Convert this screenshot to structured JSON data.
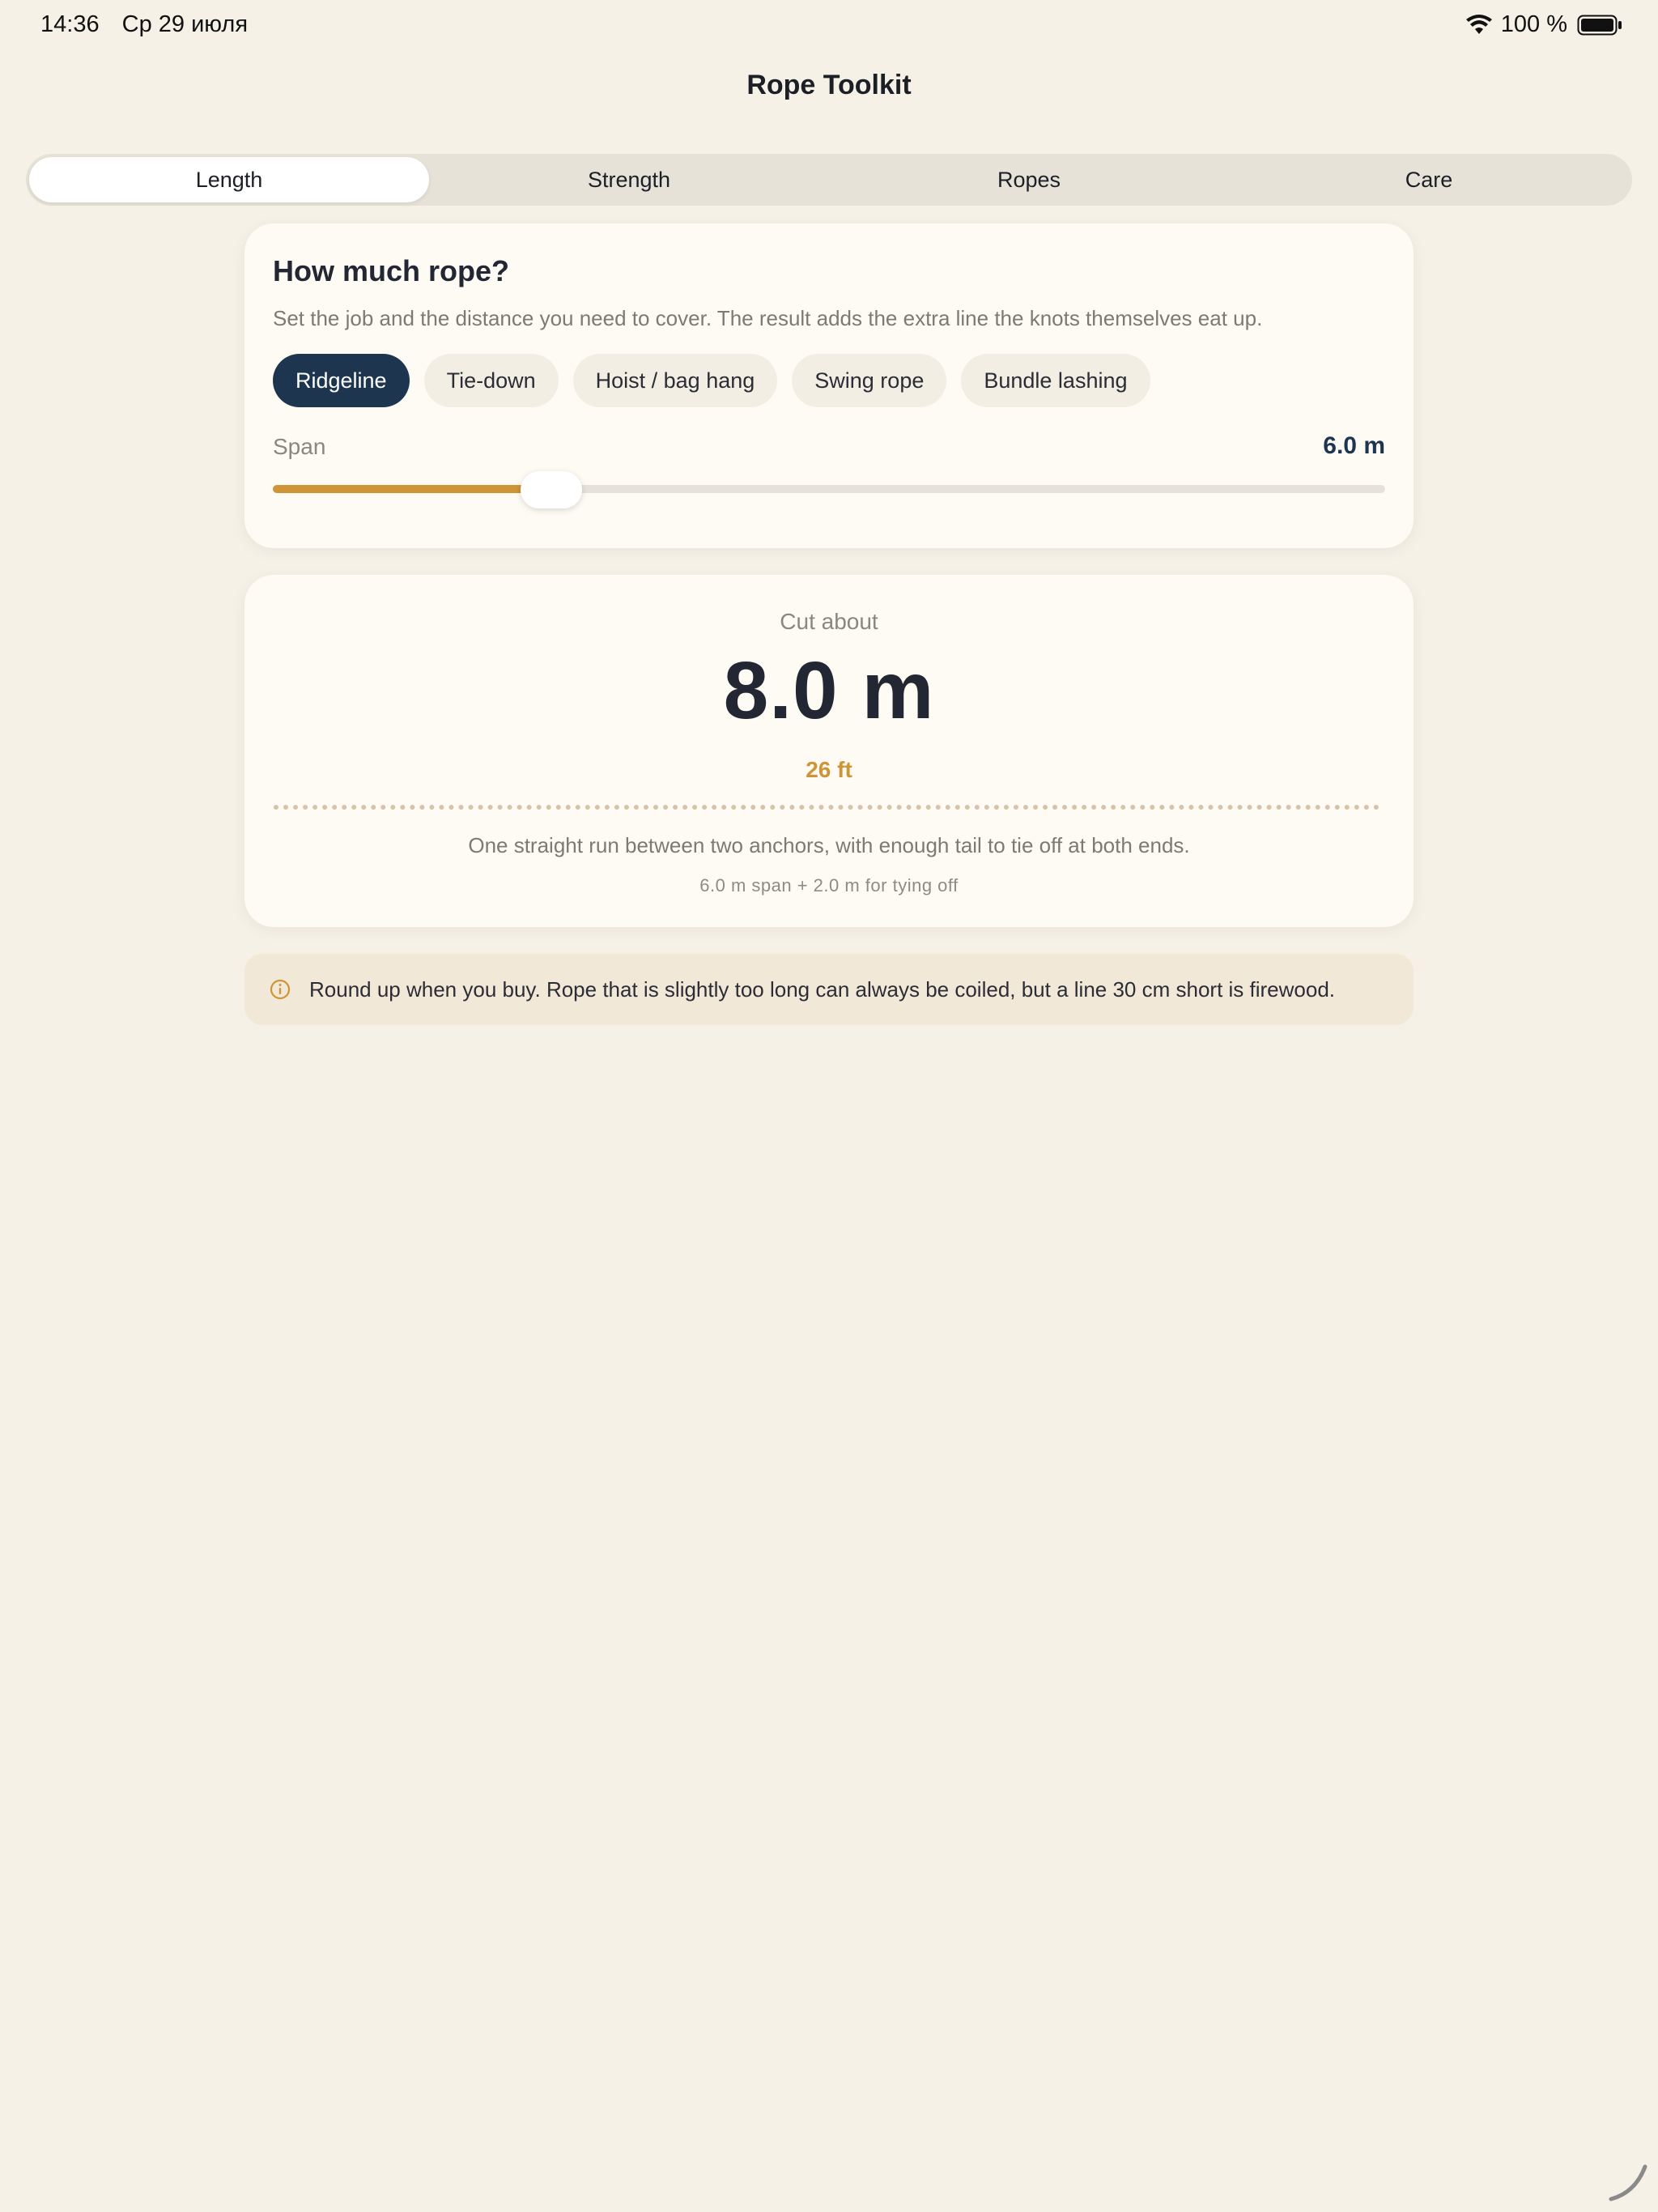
{
  "status_bar": {
    "time": "14:36",
    "date": "Ср 29 июля",
    "battery": "100 %"
  },
  "nav": {
    "title": "Rope Toolkit"
  },
  "tabs": [
    {
      "label": "Length",
      "active": true
    },
    {
      "label": "Strength",
      "active": false
    },
    {
      "label": "Ropes",
      "active": false
    },
    {
      "label": "Care",
      "active": false
    }
  ],
  "input_card": {
    "title": "How much rope?",
    "description": "Set the job and the distance you need to cover. The result adds the extra line the knots themselves eat up.",
    "chips": [
      {
        "label": "Ridgeline",
        "active": true
      },
      {
        "label": "Tie-down",
        "active": false
      },
      {
        "label": "Hoist / bag hang",
        "active": false
      },
      {
        "label": "Swing rope",
        "active": false
      },
      {
        "label": "Bundle lashing",
        "active": false
      }
    ],
    "span_label": "Span",
    "span_value": "6.0 m",
    "slider_fraction": 0.223
  },
  "result_card": {
    "label": "Cut about",
    "main_value": "8.0 m",
    "alt_value": "26 ft",
    "description": "One straight run between two anchors, with enough tail to tie off at both ends.",
    "formula": "6.0 m span + 2.0 m for tying off"
  },
  "tip": {
    "text": "Round up when you buy. Rope that is slightly too long can always be coiled, but a line 30 cm short is firewood."
  },
  "colors": {
    "accent": "#cf9435",
    "navy": "#1e3550",
    "background": "#f5f1e7"
  }
}
